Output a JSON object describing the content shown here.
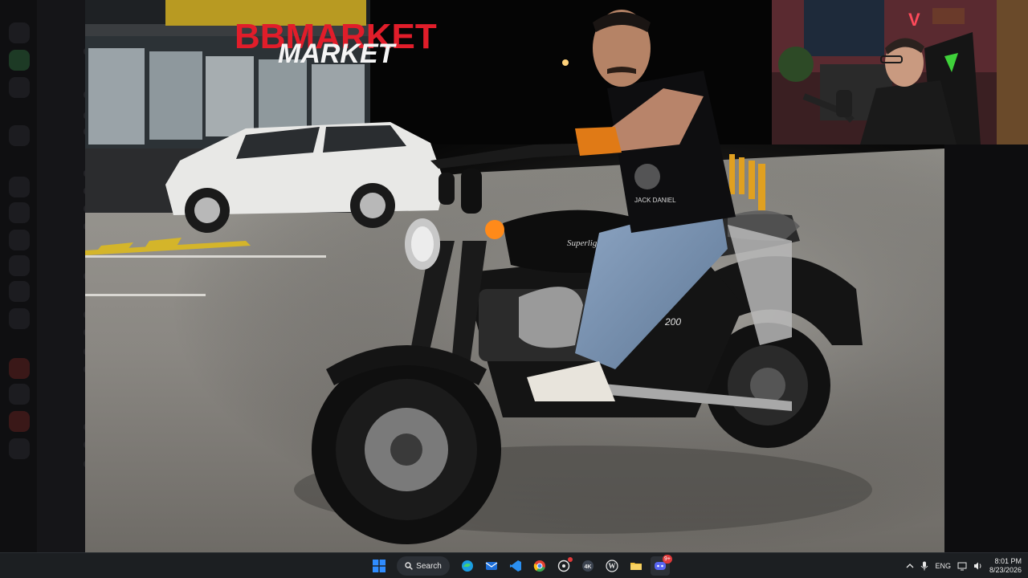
{
  "photo": {
    "store_sign": "BBMARKET",
    "tank_script": "Superlight",
    "engine_badge": "200",
    "shirt_print": "JACK DANIEL"
  },
  "taskbar": {
    "search_label": "Search",
    "lang": "ENG",
    "time": "8:01 PM",
    "date": "8/23/2026",
    "discord_badge": "9+",
    "apps": [
      {
        "name": "start-icon"
      },
      {
        "name": "edge-icon"
      },
      {
        "name": "mail-icon"
      },
      {
        "name": "vscode-icon"
      },
      {
        "name": "chrome-icon"
      },
      {
        "name": "app-icon"
      },
      {
        "name": "4k-icon",
        "label": "4K"
      },
      {
        "name": "wordpress-icon",
        "label": "W"
      },
      {
        "name": "folder-icon"
      },
      {
        "name": "discord-icon"
      }
    ]
  },
  "colors": {
    "taskbar": "#1c1f22",
    "accent_blue": "#2f8cff",
    "sign_red": "#e11d2a",
    "sign_green": "#46b83a"
  }
}
